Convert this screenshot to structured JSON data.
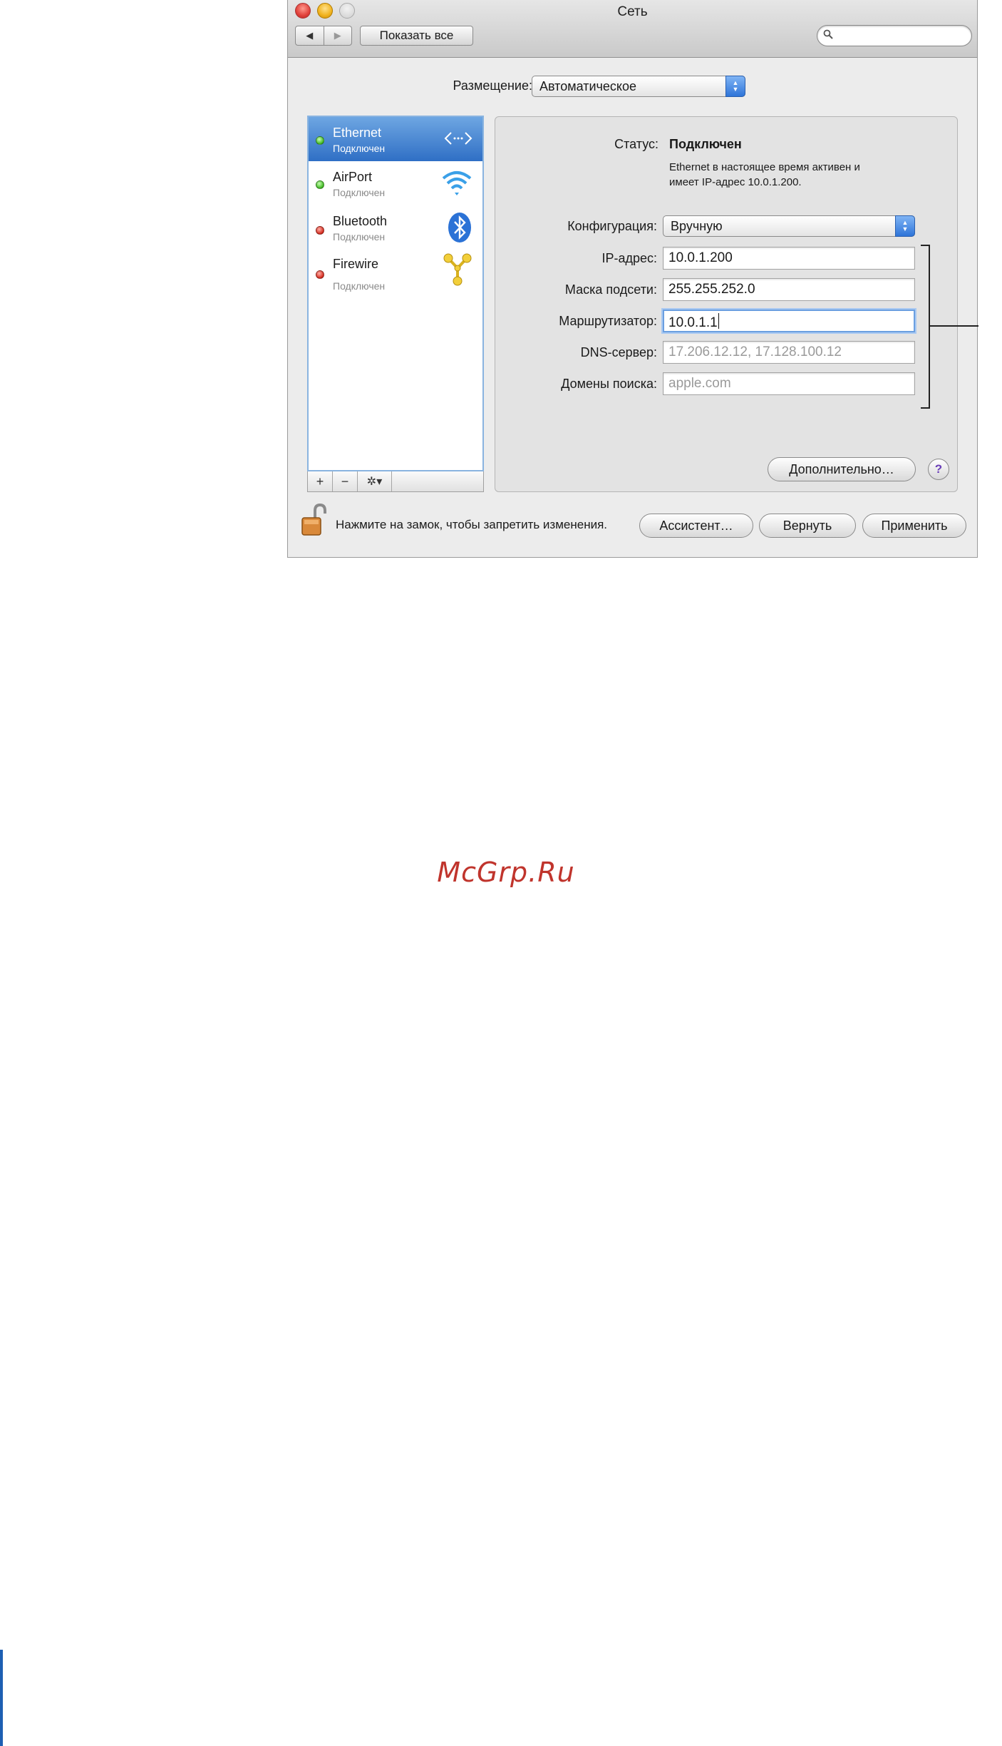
{
  "window": {
    "title": "Сеть",
    "show_all_label": "Показать все",
    "back_glyph": "◀",
    "forward_glyph": "▶",
    "search": {
      "placeholder": "",
      "icon": "search-icon"
    }
  },
  "location": {
    "label": "Размещение:",
    "value": "Автоматическое"
  },
  "services": [
    {
      "name": "Ethernet",
      "status": "Подключен",
      "indicator": "green",
      "icon": "ethernet-arrows-icon",
      "selected": true
    },
    {
      "name": "AirPort",
      "status": "Подключен",
      "indicator": "green",
      "icon": "wifi-icon",
      "selected": false
    },
    {
      "name": "Bluetooth",
      "status": "Подключен",
      "indicator": "red",
      "icon": "bluetooth-icon",
      "selected": false
    },
    {
      "name": "Firewire",
      "status": "Подключен",
      "indicator": "red",
      "icon": "firewire-icon",
      "selected": false
    }
  ],
  "sidebar_toolbar": {
    "add": "+",
    "remove": "−",
    "action": "✲▾"
  },
  "detail": {
    "status_label": "Статус:",
    "status_value": "Подключен",
    "status_desc_line1": "Ethernet в настоящее время активен и",
    "status_desc_line2": "имеет IP-адрес 10.0.1.200.",
    "config_label": "Конфигурация:",
    "config_value": "Вручную",
    "fields": {
      "ip": {
        "label": "IP-адрес:",
        "value": "10.0.1.200"
      },
      "mask": {
        "label": "Маска подсети:",
        "value": "255.255.252.0"
      },
      "router": {
        "label": "Маршрутизатор:",
        "value": "10.0.1.1"
      },
      "dns": {
        "label": "DNS-сервер:",
        "placeholder": "17.206.12.12, 17.128.100.12"
      },
      "search_domains": {
        "label": "Домены поиска:",
        "placeholder": "apple.com"
      }
    },
    "advanced_label": "Дополнительно…",
    "help_label": "?"
  },
  "footer": {
    "lock_text": "Нажмите на замок, чтобы запретить изменения.",
    "assistant_label": "Ассистент…",
    "revert_label": "Вернуть",
    "apply_label": "Применить"
  },
  "watermark": "McGrp.Ru",
  "colors": {
    "selection": "#3a7bd5",
    "status_green": "#3fb822",
    "status_red": "#d42a1d",
    "watermark": "#c0342c"
  }
}
